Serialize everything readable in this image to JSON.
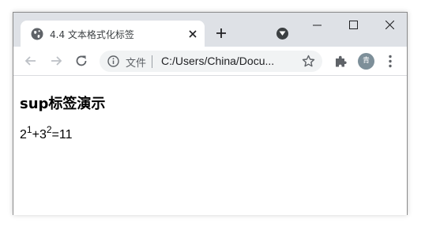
{
  "tab": {
    "title": "4.4 文本格式化标签",
    "favicon": "globe-icon"
  },
  "window_controls": [
    "minimize-icon",
    "maximize-icon",
    "close-icon"
  ],
  "toolbar": {
    "back": "arrow-left-icon",
    "forward": "arrow-right-icon",
    "reload": "reload-icon",
    "chip_label": "文件",
    "url": "C:/Users/China/Docu...",
    "avatar_label": "青"
  },
  "page": {
    "heading": "sup标签演示",
    "formula": {
      "base1": "2",
      "exp1": "1",
      "plus": "+",
      "base2": "3",
      "exp2": "2",
      "result": "=11"
    }
  },
  "colors": {
    "titlebar": "#dee1e6",
    "omnibox": "#f1f3f4",
    "avatar": "#7d8f99",
    "icon": "#5f6368"
  }
}
